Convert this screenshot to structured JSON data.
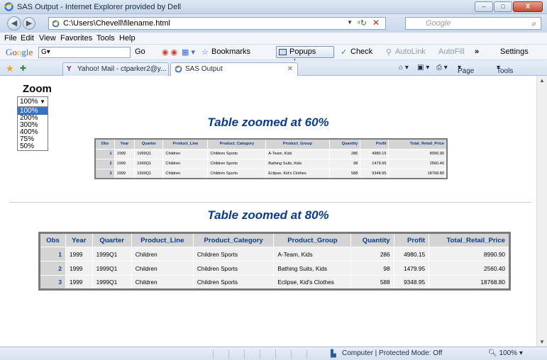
{
  "window": {
    "title": "SAS Output - Internet Explorer provided by Dell",
    "controls": [
      "–",
      "□",
      "X"
    ]
  },
  "address": {
    "url": "C:\\Users\\Chevell\\filename.html",
    "search_placeholder": "Google"
  },
  "menu": [
    "File",
    "Edit",
    "View",
    "Favorites",
    "Tools",
    "Help"
  ],
  "google_toolbar": {
    "logo": "Google",
    "go": "Go",
    "bookmarks": "Bookmarks",
    "popups": "Popups okay",
    "check": "Check",
    "autolink": "AutoLink",
    "autofill": "AutoFill",
    "more": "»",
    "settings": "Settings"
  },
  "tabs": [
    {
      "label": "Yahoo! Mail - ctparker2@y..."
    },
    {
      "label": "SAS Output"
    }
  ],
  "command_bar": {
    "page": "Page",
    "tools": "Tools"
  },
  "zoom_widget": {
    "label": "Zoom",
    "selected": "100%",
    "options": [
      "100%",
      "200%",
      "300%",
      "400%",
      "75%",
      "50%"
    ]
  },
  "headings": {
    "t60": "Table zoomed at 60%",
    "t80": "Table zoomed at 80%"
  },
  "table": {
    "columns": [
      "Obs",
      "Year",
      "Quarter",
      "Product_Line",
      "Product_Category",
      "Product_Group",
      "Quantity",
      "Profit",
      "Total_Retail_Price"
    ],
    "rows": [
      [
        "1",
        "1999",
        "1999Q1",
        "Children",
        "Children Sports",
        "A-Team, Kids",
        "286",
        "4980.15",
        "8990.90"
      ],
      [
        "2",
        "1999",
        "1999Q1",
        "Children",
        "Children Sports",
        "Bathing Suits, Kids",
        "98",
        "1479.95",
        "2560.40"
      ],
      [
        "3",
        "1999",
        "1999Q1",
        "Children",
        "Children Sports",
        "Eclipse, Kid's Clothes",
        "588",
        "9348.95",
        "18768.80"
      ]
    ]
  },
  "status": {
    "zone": "Computer | Protected Mode: Off",
    "zoom": "100%"
  }
}
